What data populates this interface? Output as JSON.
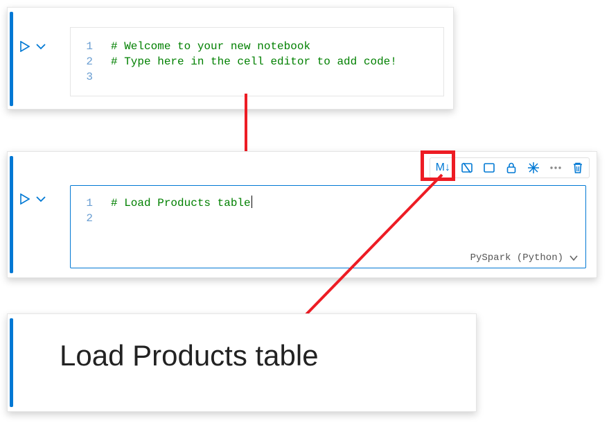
{
  "cell1": {
    "lines": [
      {
        "num": "1",
        "text": "# Welcome to your new notebook"
      },
      {
        "num": "2",
        "text": "# Type here in the cell editor to add code!"
      },
      {
        "num": "3",
        "text": ""
      }
    ]
  },
  "cell2": {
    "lines": [
      {
        "num": "1",
        "text": "# Load Products table"
      },
      {
        "num": "2",
        "text": ""
      }
    ],
    "language": "PySpark (Python)",
    "toolbar": {
      "markdown_label": "M↓"
    }
  },
  "markdown_cell": {
    "heading": "Load Products table"
  }
}
